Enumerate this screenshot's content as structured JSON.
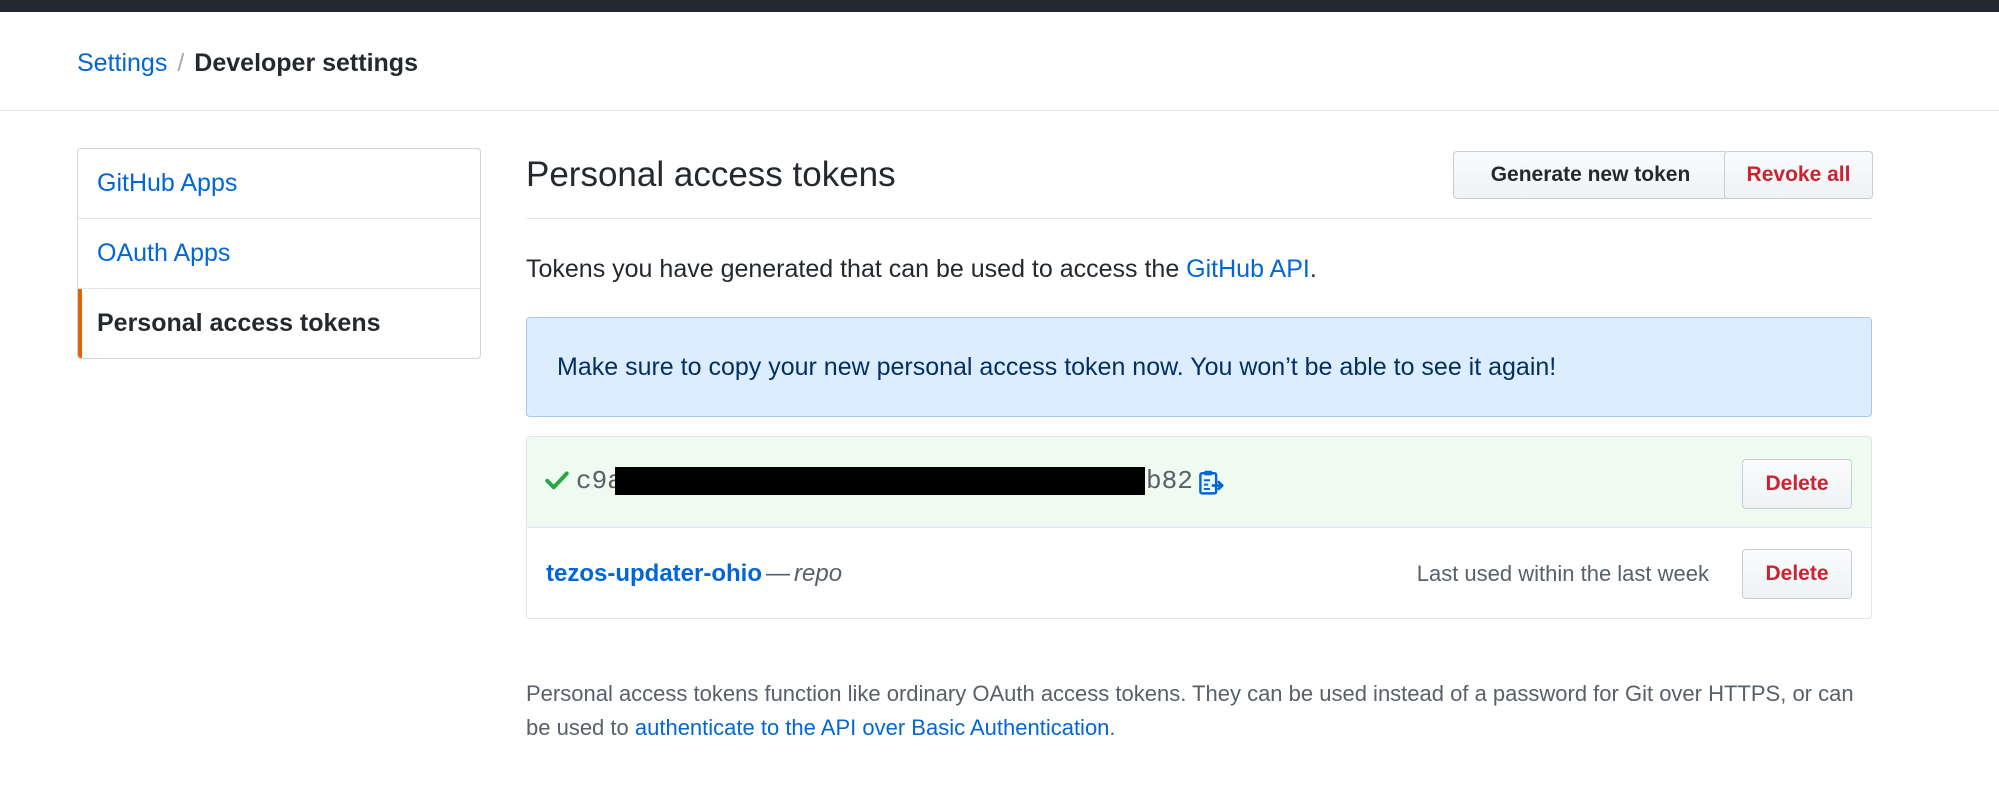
{
  "breadcrumb": {
    "root": "Settings",
    "separator": "/",
    "current": "Developer settings"
  },
  "sidebar": {
    "items": [
      {
        "label": "GitHub Apps"
      },
      {
        "label": "OAuth Apps"
      },
      {
        "label": "Personal access tokens",
        "selected": true
      }
    ]
  },
  "main": {
    "title": "Personal access tokens",
    "generate_button": "Generate new token",
    "revoke_button": "Revoke all",
    "intro_text": "Tokens you have generated that can be used to access the ",
    "intro_link": "GitHub API",
    "intro_end": "."
  },
  "flash": {
    "message": "Make sure to copy your new personal access token now. You won’t be able to see it again!"
  },
  "new_token": {
    "prefix": "c9a",
    "suffix": "b82",
    "delete_label": "Delete"
  },
  "tokens": [
    {
      "name": "tezos-updater-ohio",
      "dash": "—",
      "scope": "repo",
      "last_used": "Last used within the last week",
      "delete_label": "Delete"
    }
  ],
  "footnote": {
    "text1": "Personal access tokens function like ordinary OAuth access tokens. They can be used instead of a password for Git over HTTPS, or can be used to ",
    "link": "authenticate to the API over Basic Authentication",
    "text2": "."
  },
  "colors": {
    "link": "#0366d6",
    "danger": "#cb2431",
    "selected_accent": "#e36209",
    "flash_bg": "#dbedff",
    "success_bg": "#effaf0",
    "check": "#28a745"
  },
  "icons": [
    "check-icon",
    "clippy-icon"
  ]
}
